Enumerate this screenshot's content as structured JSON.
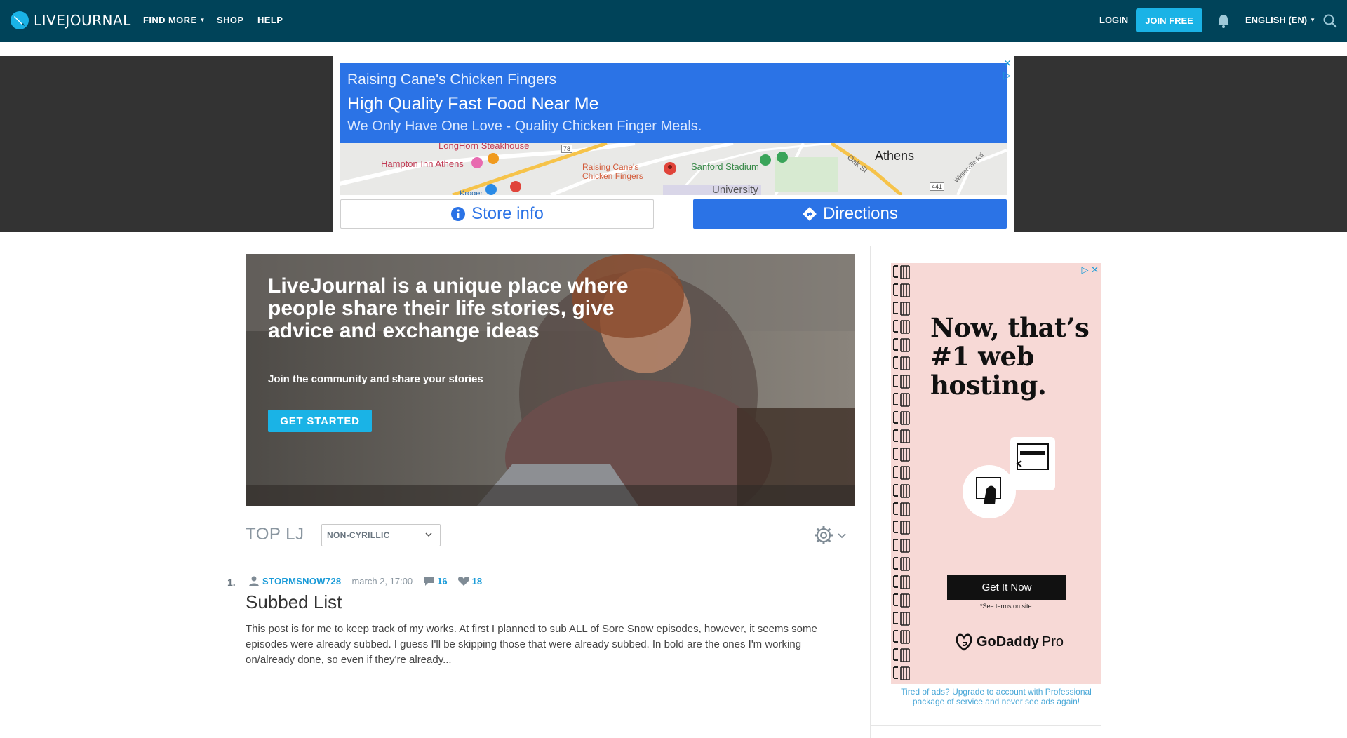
{
  "header": {
    "logo_text": "LIVEJOURNAL",
    "nav": [
      {
        "label": "FIND MORE",
        "has_caret": true
      },
      {
        "label": "SHOP",
        "has_caret": false
      },
      {
        "label": "HELP",
        "has_caret": false
      }
    ],
    "login_label": "LOGIN",
    "join_label": "JOIN FREE",
    "language_label": "ENGLISH (EN)",
    "icons": [
      "livejournal-logo-icon",
      "bell-icon",
      "search-icon"
    ]
  },
  "top_ad": {
    "line1": "Raising Cane's Chicken Fingers",
    "line2": "High Quality Fast Food Near Me",
    "line3": "We Only Have One Love - Quality Chicken Finger Meals.",
    "map_labels": {
      "steakhouse": "LongHorn Steakhouse",
      "hampton": "Hampton Inn Athens",
      "canes": "Raising Cane's Chicken Fingers",
      "stadium": "Sanford Stadium",
      "athens": "Athens",
      "oak": "Oak St",
      "university": "University",
      "kroger": "Kroger",
      "winterville": "Winterville Rd",
      "route78": "78",
      "route441": "441"
    },
    "store_info_label": "Store info",
    "directions_label": "Directions"
  },
  "hero": {
    "title": "LiveJournal is a unique place where people share their life stories, give advice and exchange ideas",
    "subtitle": "Join the community and share your stories",
    "cta_label": "GET STARTED"
  },
  "top_lj": {
    "title": "TOP LJ",
    "filter_value": "NON-CYRILLIC"
  },
  "posts": [
    {
      "rank": "1.",
      "username": "STORMSNOW728",
      "date": "march 2, 17:00",
      "comments": "16",
      "likes": "18",
      "title": "Subbed List",
      "excerpt": "This post is for me to keep track of my works. At first I planned to sub ALL of Sore Snow episodes, however, it seems some episodes were already subbed. I guess I'll be skipping those that were already subbed. In bold are the ones I'm working on/already done, so even if they're already..."
    }
  ],
  "side_ad": {
    "headline": "Now, that’s #1 web hosting.",
    "button_label": "Get It Now",
    "terms": "*See terms on site.",
    "brand": "GoDaddy",
    "brand_suffix": "Pro",
    "upgrade_note": "Tired of ads? Upgrade to account with Professional package of service and never see ads again!"
  },
  "colors": {
    "topbar": "#004359",
    "accent": "#1ab3e6",
    "ad_blue": "#2b73e6",
    "side_ad_bg": "#f7d9d6"
  }
}
